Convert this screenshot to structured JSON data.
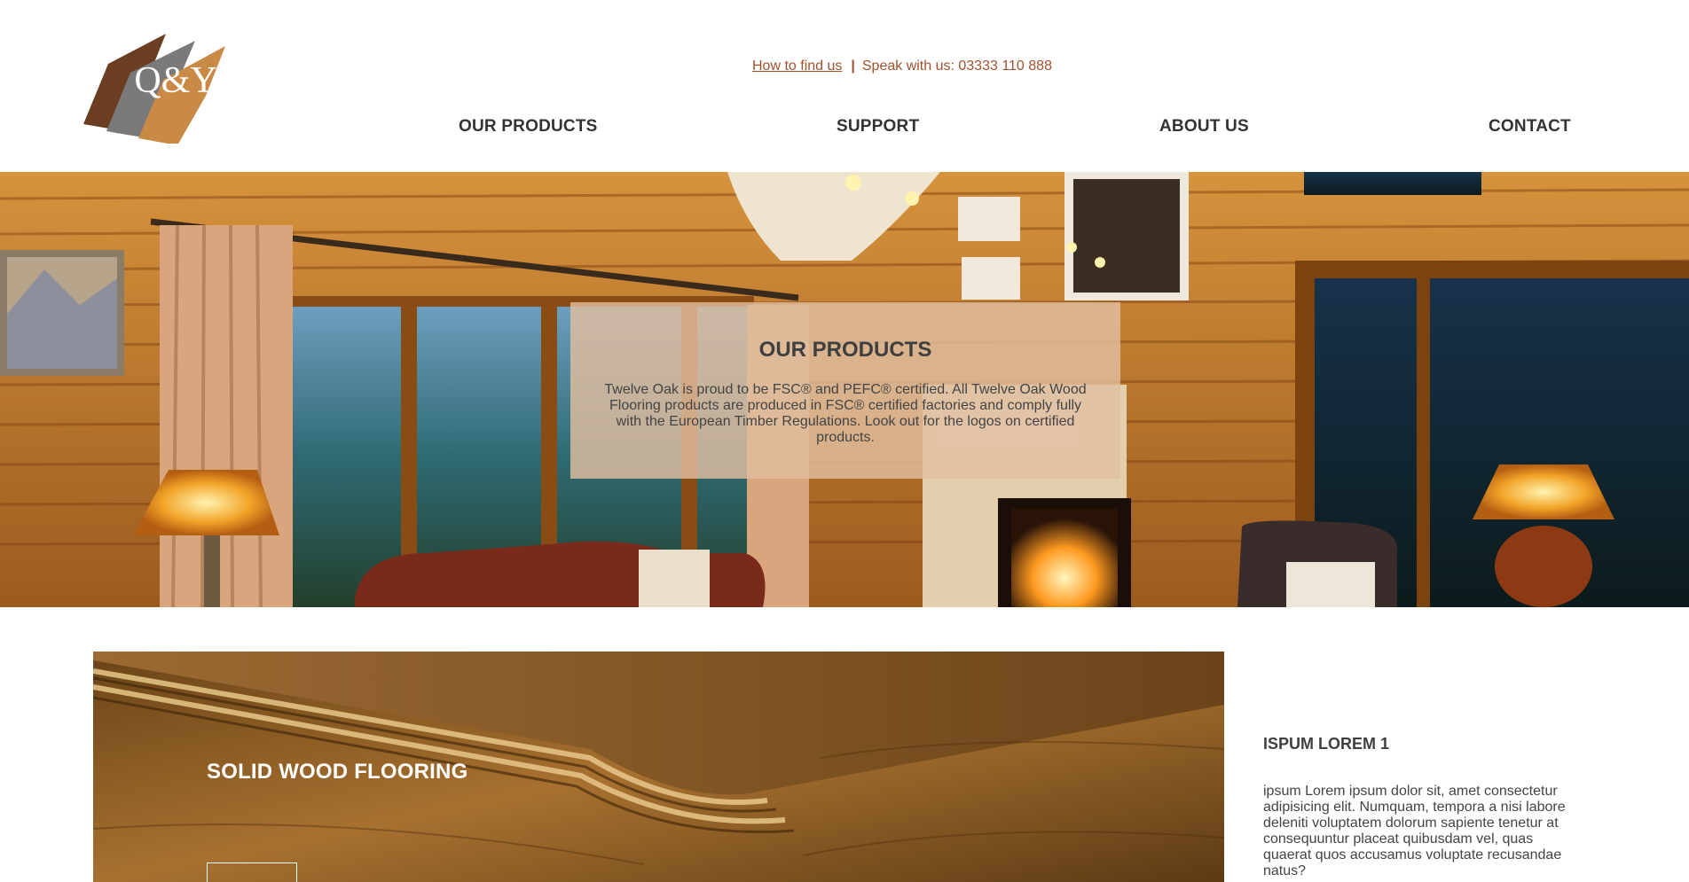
{
  "brand": {
    "logo_text": "Q&Y",
    "colors": [
      "#6b3e22",
      "#7a7a7a",
      "#c98a45"
    ]
  },
  "topbar": {
    "find_link": "How to find us",
    "separator": "|",
    "speak": "Speak with us: 03333 110 888",
    "accent": "#a0522d"
  },
  "nav": {
    "products": "OUR PRODUCTS",
    "support": "SUPPORT",
    "about": "ABOUT US",
    "contact": "CONTACT"
  },
  "hero": {
    "title": "OUR PRODUCTS",
    "text": "Twelve Oak is proud to be FSC® and PEFC® certified. All Twelve Oak Wood Flooring products are produced in FSC® certified factories and comply fully with the European Timber Regulations. Look out for the logos on certified products."
  },
  "product": {
    "title": "SOLID WOOD FLOORING"
  },
  "sidebar": {
    "title": "ISPUM LOREM 1",
    "text": "ipsum Lorem ipsum dolor sit, amet consectetur adipisicing elit. Numquam, tempora a nisi labore deleniti voluptatem dolorum sapiente tenetur at consequuntur placeat quibusdam vel, quas quaerat quos accusamus voluptate recusandae natus?"
  }
}
